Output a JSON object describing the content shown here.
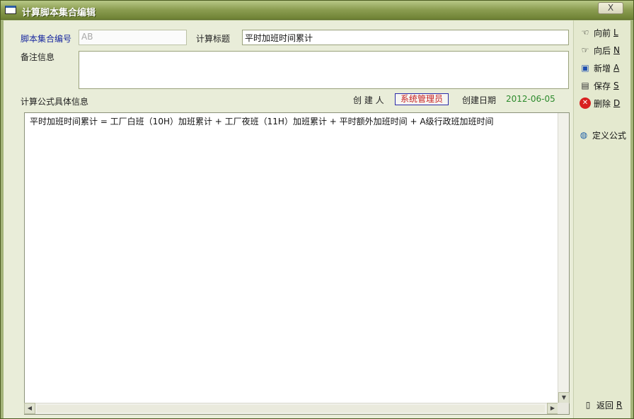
{
  "window": {
    "title": "计算脚本集合编辑",
    "close_label": "X"
  },
  "form": {
    "collection_no_label": "脚本集合编号",
    "collection_no_value": "AB",
    "calc_title_label": "计算标题",
    "calc_title_value": "平时加班时间累计",
    "remarks_label": "备注信息",
    "remarks_value": "",
    "formula_section_label": "计算公式具体信息",
    "creator_label": "创 建 人",
    "creator_value": "系统管理员",
    "created_date_label": "创建日期",
    "created_date_value": "2012-06-05"
  },
  "editor": {
    "content": "平时加班时间累计 = 工厂白班（10H）加班累计 + 工厂夜班（11H）加班累计 + 平时额外加班时间 + A级行政班加班时间"
  },
  "sidebar": {
    "prev": {
      "label": "向前",
      "key": "L"
    },
    "next": {
      "label": "向后",
      "key": "N"
    },
    "add": {
      "label": "新增",
      "key": "A"
    },
    "save": {
      "label": "保存",
      "key": "S"
    },
    "delete": {
      "label": "删除",
      "key": "D"
    },
    "define": {
      "label": "定义公式"
    },
    "back": {
      "label": "返回",
      "key": "R"
    }
  },
  "colors": {
    "accent_blue": "#1a2aa0",
    "creator_red": "#c82020",
    "date_green": "#2c8a2c",
    "titlebar": "#6f8235"
  },
  "icons": [
    "window-icon",
    "prev-hand-icon",
    "next-hand-icon",
    "add-record-icon",
    "save-disk-icon",
    "delete-x-icon",
    "define-globe-icon",
    "exit-door-icon"
  ]
}
